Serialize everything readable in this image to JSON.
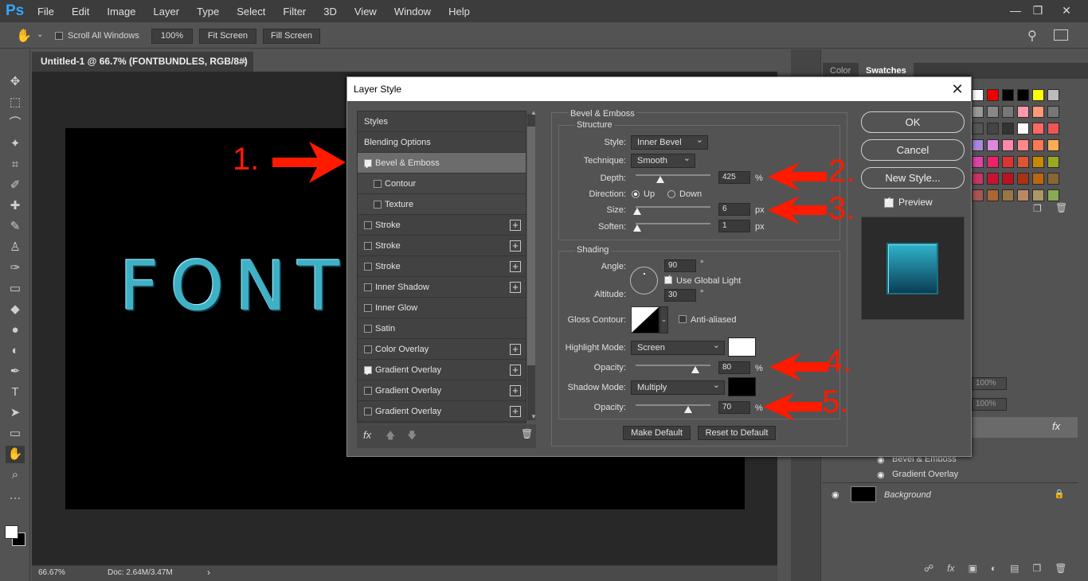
{
  "app": {
    "logo": "Ps",
    "menu": [
      "File",
      "Edit",
      "Image",
      "Layer",
      "Type",
      "Select",
      "Filter",
      "3D",
      "View",
      "Window",
      "Help"
    ]
  },
  "options": {
    "scroll_all": "Scroll All Windows",
    "zoom_btn": "100%",
    "fit_screen": "Fit Screen",
    "fill_screen": "Fill Screen"
  },
  "document": {
    "tab_title": "Untitled-1 @ 66.7% (FONTBUNDLES, RGB/8#) *",
    "canvas_text": "FONTB",
    "zoom": "66.67%",
    "doc_size": "Doc: 2.64M/3.47M"
  },
  "swatches_panel": {
    "tabs": [
      "Color",
      "Swatches"
    ]
  },
  "layers_panel": {
    "opacity1": "100%",
    "opacity2": "100%",
    "effects": [
      "Bevel & Emboss",
      "Gradient Overlay"
    ],
    "background": "Background",
    "fx": "fx"
  },
  "dialog": {
    "title": "Layer Style",
    "styles": [
      {
        "label": "Styles",
        "checkbox": false,
        "checked": false,
        "plus": false
      },
      {
        "label": "Blending Options",
        "checkbox": false,
        "checked": false,
        "plus": false
      },
      {
        "label": "Bevel & Emboss",
        "checkbox": true,
        "checked": true,
        "plus": false,
        "selected": true
      },
      {
        "label": "Contour",
        "checkbox": true,
        "checked": false,
        "plus": false,
        "indent": true
      },
      {
        "label": "Texture",
        "checkbox": true,
        "checked": false,
        "plus": false,
        "indent": true
      },
      {
        "label": "Stroke",
        "checkbox": true,
        "checked": false,
        "plus": true
      },
      {
        "label": "Stroke",
        "checkbox": true,
        "checked": false,
        "plus": true
      },
      {
        "label": "Stroke",
        "checkbox": true,
        "checked": false,
        "plus": true
      },
      {
        "label": "Inner Shadow",
        "checkbox": true,
        "checked": false,
        "plus": true
      },
      {
        "label": "Inner Glow",
        "checkbox": true,
        "checked": false,
        "plus": false
      },
      {
        "label": "Satin",
        "checkbox": true,
        "checked": false,
        "plus": false
      },
      {
        "label": "Color Overlay",
        "checkbox": true,
        "checked": false,
        "plus": true
      },
      {
        "label": "Gradient Overlay",
        "checkbox": true,
        "checked": true,
        "plus": true
      },
      {
        "label": "Gradient Overlay",
        "checkbox": true,
        "checked": false,
        "plus": true
      },
      {
        "label": "Gradient Overlay",
        "checkbox": true,
        "checked": false,
        "plus": true
      }
    ],
    "fx_label": "fx",
    "bevel": {
      "section_title": "Bevel & Emboss",
      "structure_title": "Structure",
      "style_label": "Style:",
      "style_value": "Inner Bevel",
      "technique_label": "Technique:",
      "technique_value": "Smooth",
      "depth_label": "Depth:",
      "depth_value": "425",
      "depth_unit": "%",
      "depth_slider": 0.33,
      "direction_label": "Direction:",
      "dir_up": "Up",
      "dir_down": "Down",
      "size_label": "Size:",
      "size_value": "6",
      "size_unit": "px",
      "size_slider": 0.02,
      "soften_label": "Soften:",
      "soften_value": "1",
      "soften_unit": "px",
      "soften_slider": 0.02
    },
    "shading": {
      "title": "Shading",
      "angle_label": "Angle:",
      "angle_value": "90",
      "deg": "°",
      "global_light": "Use Global Light",
      "altitude_label": "Altitude:",
      "altitude_value": "30",
      "gloss_label": "Gloss Contour:",
      "anti_aliased": "Anti-aliased",
      "highlight_label": "Highlight Mode:",
      "highlight_value": "Screen",
      "highlight_color": "#ffffff",
      "hopacity_label": "Opacity:",
      "hopacity_value": "80",
      "hopacity_unit": "%",
      "hopacity_slider": 0.8,
      "shadow_label": "Shadow Mode:",
      "shadow_value": "Multiply",
      "shadow_color": "#000000",
      "sopacity_label": "Opacity:",
      "sopacity_value": "70",
      "sopacity_unit": "%",
      "sopacity_slider": 0.7
    },
    "make_default": "Make Default",
    "reset_default": "Reset to Default",
    "ok": "OK",
    "cancel": "Cancel",
    "new_style": "New Style...",
    "preview": "Preview"
  },
  "annotations": [
    "1.",
    "2.",
    "3.",
    "4.",
    "5."
  ],
  "colors": {
    "annotation": "#ff1a00",
    "ps_blue": "#31a8ff"
  }
}
